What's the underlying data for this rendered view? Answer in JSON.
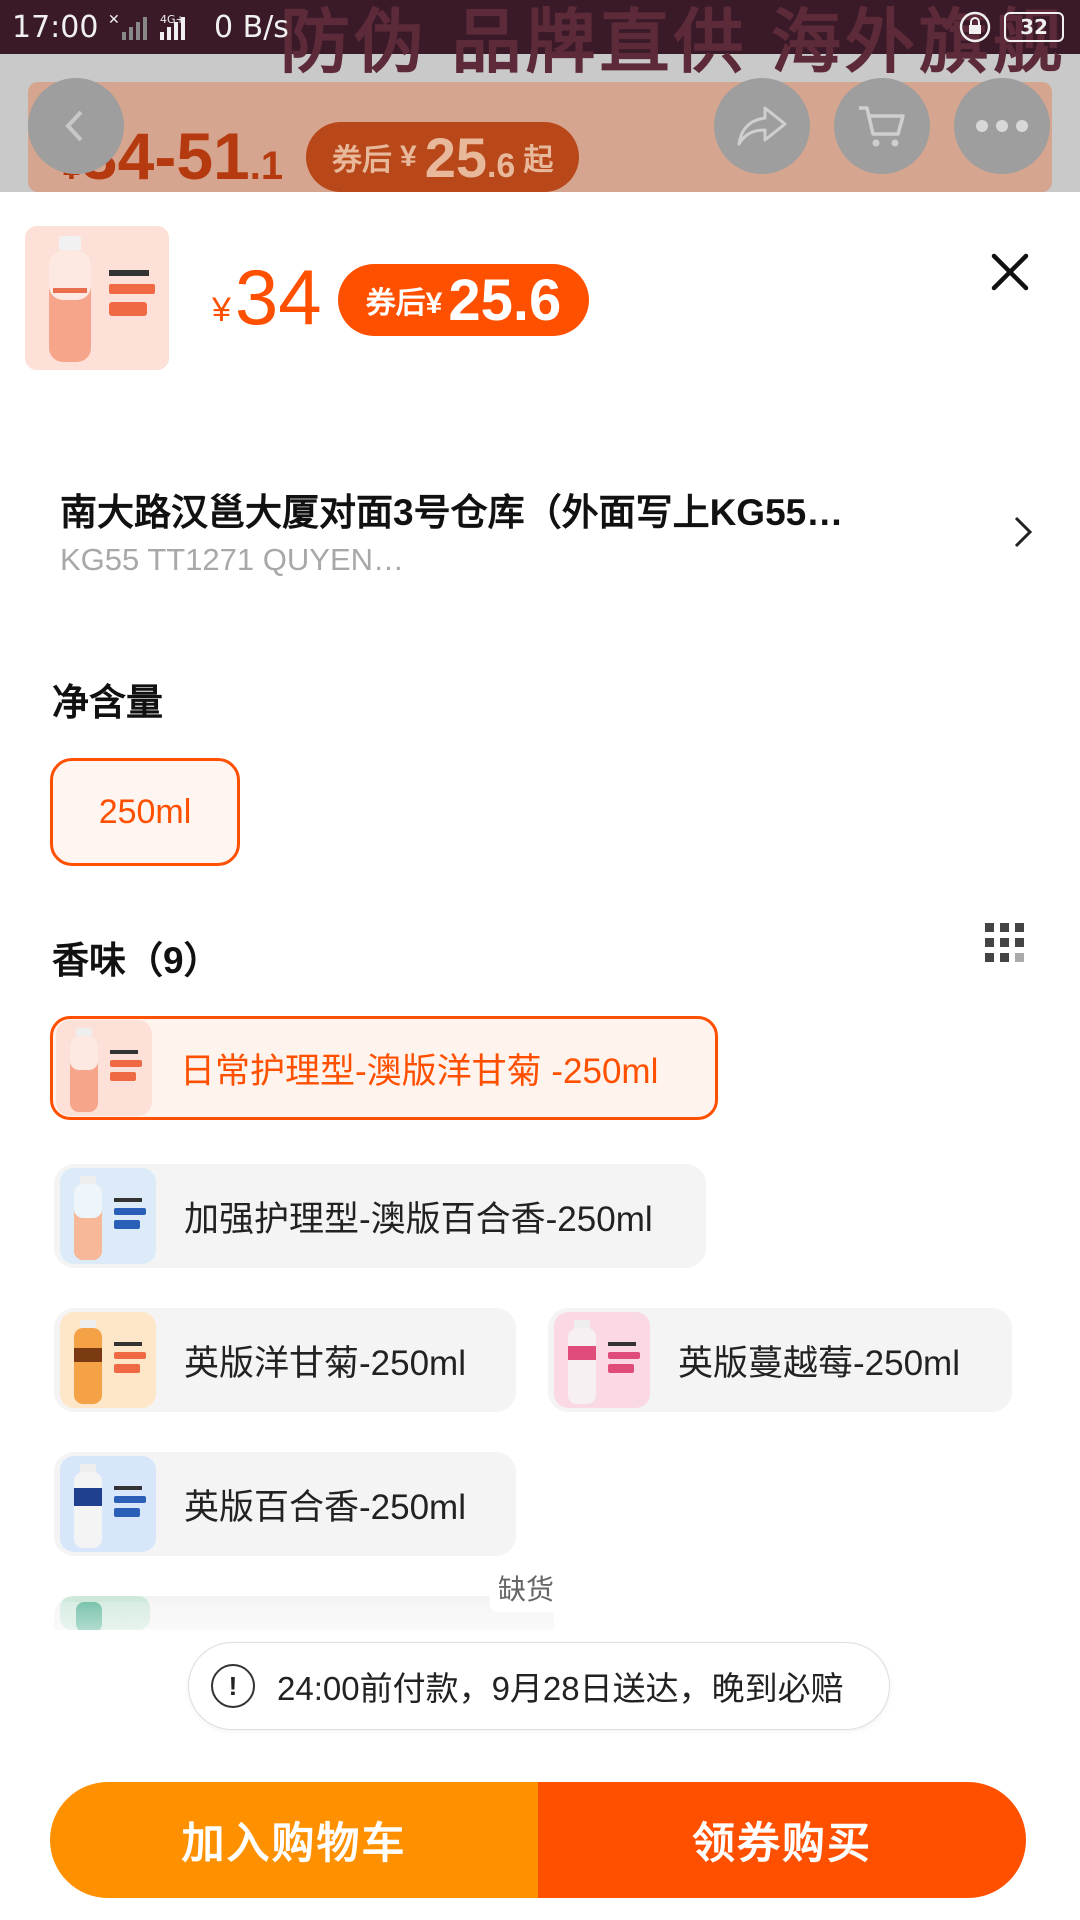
{
  "status_bar": {
    "time": "17:00",
    "net_speed": "0 B/s",
    "network": "4G+",
    "battery": "32"
  },
  "background": {
    "banner_text": "防伪 品牌直供 海外旗舰",
    "price_currency": "¥",
    "price_range": "34-51",
    "price_range_decimal": ".1",
    "coupon_label": "券后",
    "coupon_currency": "¥",
    "coupon_value": "25",
    "coupon_decimal": ".6",
    "coupon_suffix": "起"
  },
  "product": {
    "price_currency": "¥",
    "price": "34",
    "coupon_label": "券后¥",
    "coupon_price": "25.6"
  },
  "address": {
    "title": "南大路汉邕大厦对面3号仓库（外面写上KG55…",
    "subtitle": "KG55 TT1271 QUYEN…"
  },
  "volume_section": {
    "title": "净含量",
    "options": [
      {
        "label": "250ml",
        "selected": true
      }
    ]
  },
  "scent_section": {
    "title": "香味（9）",
    "options": [
      {
        "label": "日常护理型-澳版洋甘菊 -250ml",
        "selected": true
      },
      {
        "label": "加强护理型-澳版百合香-250ml",
        "selected": false
      },
      {
        "label": "英版洋甘菊-250ml",
        "selected": false
      },
      {
        "label": "英版蔓越莓-250ml",
        "selected": false
      },
      {
        "label": "英版百合香-250ml",
        "selected": false
      }
    ],
    "out_of_stock_label": "缺货"
  },
  "notice": {
    "icon": "!",
    "text": "24:00前付款，9月28日送达，晚到必赔"
  },
  "actions": {
    "add_to_cart": "加入购物车",
    "buy_now": "领券购买"
  },
  "colors": {
    "accent": "#ff5000",
    "accent_light": "#ff9000"
  }
}
